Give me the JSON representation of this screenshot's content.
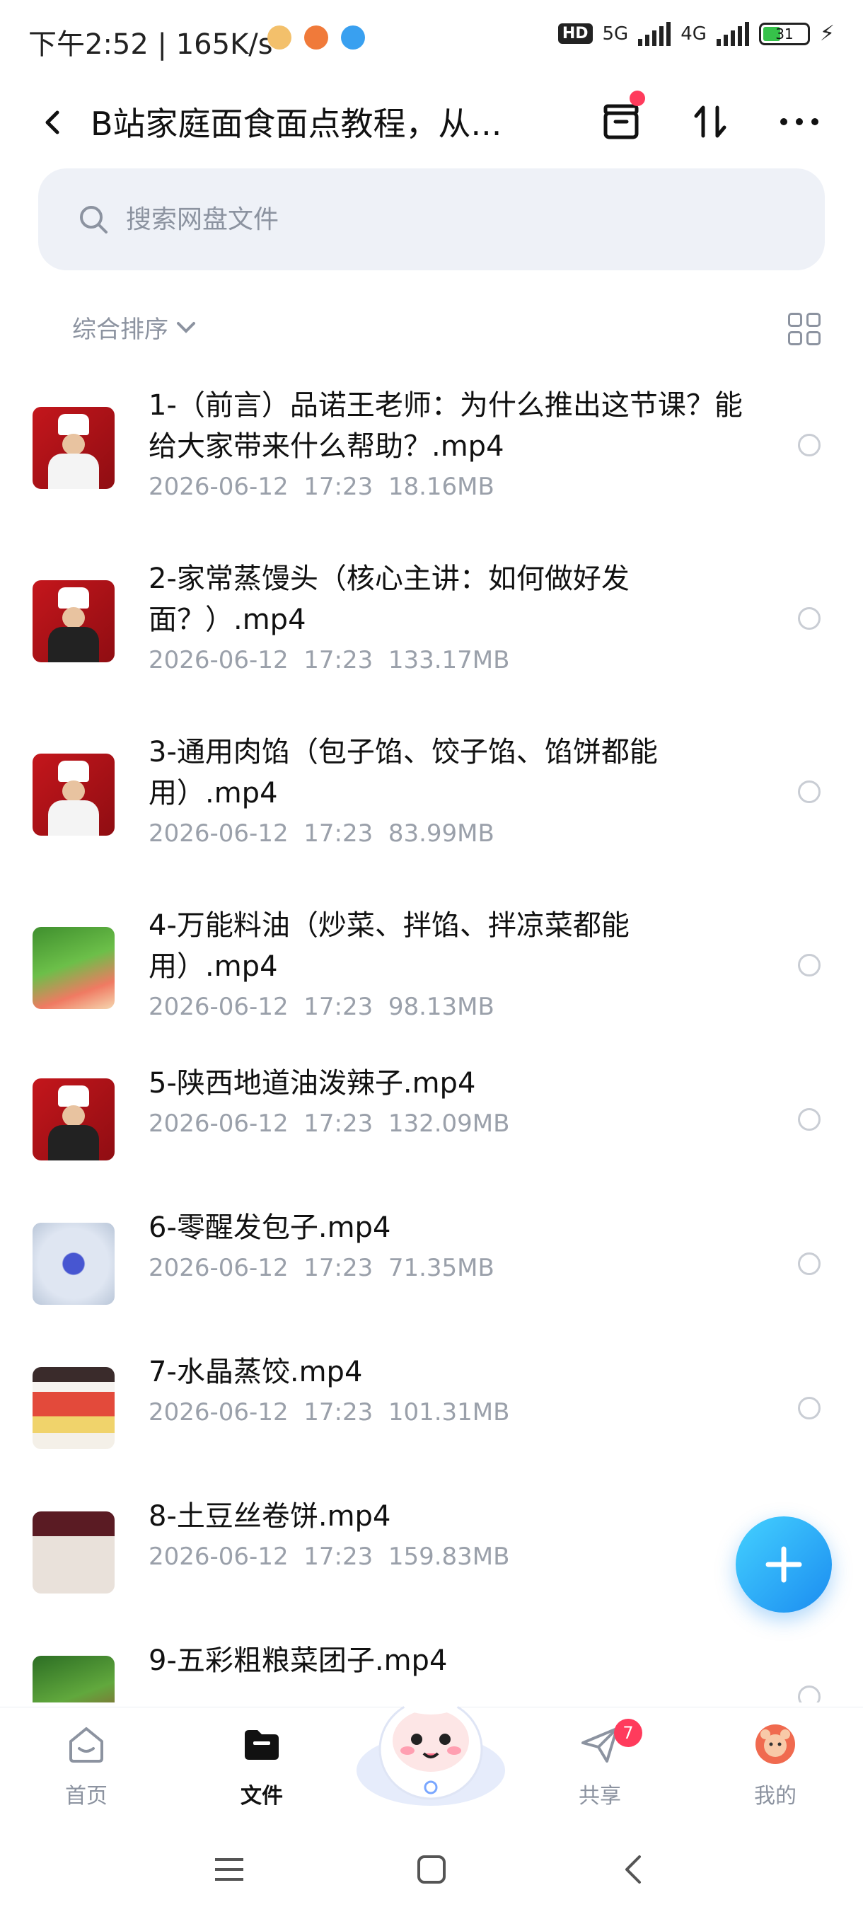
{
  "status_bar": {
    "time": "下午2:52 | 165K/s",
    "hd": "HD",
    "net1": "5G",
    "net2": "4G",
    "battery": "31"
  },
  "header": {
    "title": "B站家庭面食面点教程，从..."
  },
  "search": {
    "placeholder": "搜索网盘文件"
  },
  "sort": {
    "label": "综合排序"
  },
  "files": [
    {
      "name": "1-（前言）品诺王老师：为什么推出这节课？能给大家带来什么帮助？.mp4",
      "date": "2026-06-12",
      "time": "17:23",
      "size": "18.16MB",
      "thumb": "chef"
    },
    {
      "name": "2-家常蒸馒头（核心主讲：如何做好发面？）.mp4",
      "date": "2026-06-12",
      "time": "17:23",
      "size": "133.17MB",
      "thumb": "chef"
    },
    {
      "name": "3-通用肉馅（包子馅、饺子馅、馅饼都能用）.mp4",
      "date": "2026-06-12",
      "time": "17:23",
      "size": "83.99MB",
      "thumb": "chef"
    },
    {
      "name": "4-万能料油（炒菜、拌馅、拌凉菜都能用）.mp4",
      "date": "2026-06-12",
      "time": "17:23",
      "size": "98.13MB",
      "thumb": "veg"
    },
    {
      "name": "5-陕西地道油泼辣子.mp4",
      "date": "2026-06-12",
      "time": "17:23",
      "size": "132.09MB",
      "thumb": "chef"
    },
    {
      "name": "6-零醒发包子.mp4",
      "date": "2026-06-12",
      "time": "17:23",
      "size": "71.35MB",
      "thumb": "bun"
    },
    {
      "name": "7-水晶蒸饺.mp4",
      "date": "2026-06-12",
      "time": "17:23",
      "size": "101.31MB",
      "thumb": "dump"
    },
    {
      "name": "8-土豆丝卷饼.mp4",
      "date": "2026-06-12",
      "time": "17:23",
      "size": "159.83MB",
      "thumb": "roll"
    },
    {
      "name": "9-五彩粗粮菜团子.mp4",
      "date": "",
      "time": "",
      "size": "",
      "thumb": "green"
    }
  ],
  "nav": {
    "home": "首页",
    "files": "文件",
    "share": "共享",
    "share_badge": "7",
    "mine": "我的"
  },
  "colors": {
    "accent": "#1b8cf0",
    "badge": "#ff3b5c",
    "muted": "#8c93a0"
  }
}
